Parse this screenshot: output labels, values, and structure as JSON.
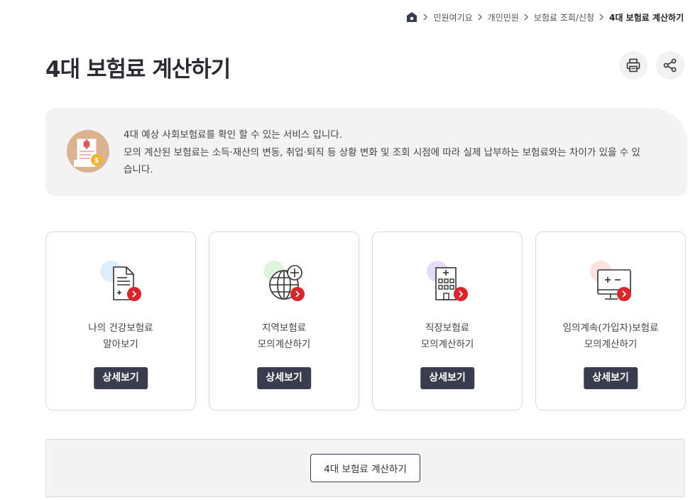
{
  "breadcrumb": {
    "items": [
      "민원여기요",
      "개인민원",
      "보험료 조회/신청"
    ],
    "current": "4대 보험료 계산하기"
  },
  "page": {
    "title": "4대 보험료 계산하기"
  },
  "info": {
    "line1": "4대 예상 사회보험료를 확인 할 수 있는 서비스 입니다.",
    "line2": "모의 계산된 보험료는 소득·재산의 변동, 취업·퇴직 등 상황 변화 및 조회 시점에 따라 실제 납부하는 보험료와는 차이가 있을 수 있습니다."
  },
  "cards": [
    {
      "title_line1": "나의 건강보험료",
      "title_line2": "알아보기",
      "button": "상세보기",
      "icon": "document-icon",
      "accent": "#dbeefa"
    },
    {
      "title_line1": "지역보험료",
      "title_line2": "모의계산하기",
      "button": "상세보기",
      "icon": "globe-icon",
      "accent": "#dcf5dc"
    },
    {
      "title_line1": "직장보험료",
      "title_line2": "모의계산하기",
      "button": "상세보기",
      "icon": "building-icon",
      "accent": "#e6dcfa"
    },
    {
      "title_line1": "임의계속(가입자)보험료",
      "title_line2": "모의계산하기",
      "button": "상세보기",
      "icon": "calculator-monitor-icon",
      "accent": "#fde0e0"
    }
  ],
  "bottom": {
    "button": "4대 보험료 계산하기"
  },
  "colors": {
    "dark": "#3a3d4d",
    "red": "#d8262c"
  }
}
